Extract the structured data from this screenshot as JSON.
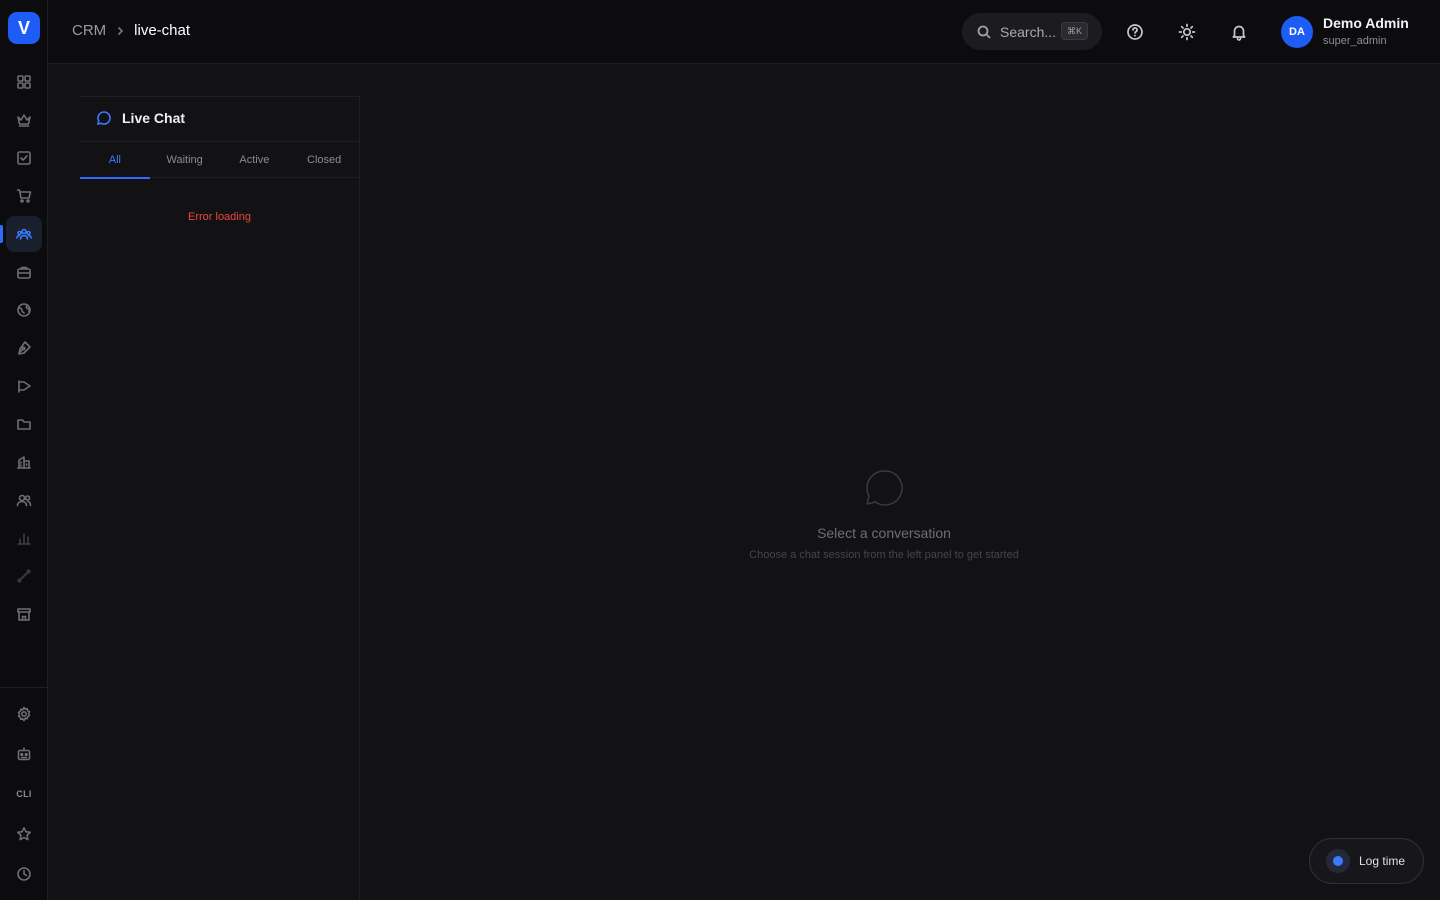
{
  "brand": {
    "logo_letter": "V",
    "accent": "#1d5cf5"
  },
  "sidebar": {
    "items": [
      {
        "icon": "grid-icon"
      },
      {
        "icon": "crown-icon"
      },
      {
        "icon": "checkbox-icon"
      },
      {
        "icon": "cart-icon"
      },
      {
        "icon": "users-icon",
        "active": true
      },
      {
        "icon": "briefcase-icon"
      },
      {
        "icon": "globe-icon"
      },
      {
        "icon": "pen-tool-icon"
      },
      {
        "icon": "megaphone-icon"
      },
      {
        "icon": "folder-icon"
      },
      {
        "icon": "building-icon"
      },
      {
        "icon": "team-icon"
      },
      {
        "icon": "bar-chart-icon"
      },
      {
        "icon": "route-icon"
      },
      {
        "icon": "store-icon"
      }
    ],
    "bottom": [
      {
        "icon": "settings-icon"
      },
      {
        "icon": "robot-icon"
      },
      {
        "label": "CLI"
      },
      {
        "icon": "star-icon"
      },
      {
        "icon": "clock-icon"
      }
    ]
  },
  "header": {
    "breadcrumb": {
      "root": "CRM",
      "current": "live-chat"
    },
    "search": {
      "placeholder": "Search...",
      "shortcut": "⌘K"
    },
    "user": {
      "initials": "DA",
      "name": "Demo Admin",
      "role": "super_admin"
    }
  },
  "chat_panel": {
    "title": "Live Chat",
    "tabs": [
      {
        "label": "All",
        "active": true
      },
      {
        "label": "Waiting"
      },
      {
        "label": "Active"
      },
      {
        "label": "Closed"
      }
    ],
    "error": "Error loading"
  },
  "empty_state": {
    "title": "Select a conversation",
    "subtitle": "Choose a chat session from the left panel to get started"
  },
  "log_time": {
    "label": "Log time"
  }
}
